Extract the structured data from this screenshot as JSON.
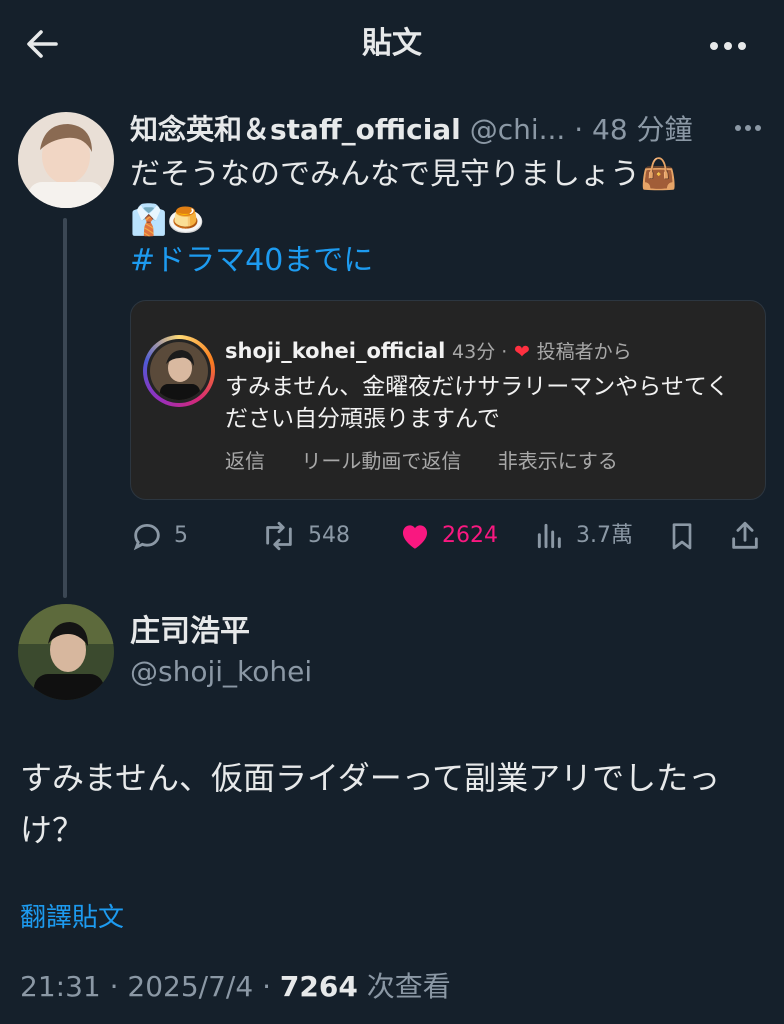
{
  "header": {
    "title": "貼文"
  },
  "quoted_tweet": {
    "author_name": "知念英和＆staff_official",
    "author_handle": "@chi...",
    "separator": "·",
    "time": "48 分鐘",
    "text_line1": "だそうなのでみんなで見守りましょう👜",
    "text_line2": "👔🍮",
    "hashtag": "#ドラマ40までに",
    "embed": {
      "username": "shoji_kohei_official",
      "meta": "43分 ·",
      "heart": "❤",
      "from_label": "投稿者から",
      "text": "すみません、金曜夜だけサラリーマンやらせてください自分頑張りますんで",
      "actions": {
        "reply": "返信",
        "reel_reply": "リール動画で返信",
        "hide": "非表示にする"
      }
    },
    "stats": {
      "replies": "5",
      "reposts": "548",
      "likes": "2624",
      "views": "3.7萬"
    },
    "colors": {
      "like": "#f91880",
      "link": "#1d9bf0"
    }
  },
  "main_tweet": {
    "author_name": "庄司浩平",
    "author_handle": "@shoji_kohei",
    "text": "すみません、仮面ライダーって副業アリでしたっけ？",
    "translate_label": "翻譯貼文",
    "time": "21:31",
    "sep1": "·",
    "date": "2025/7/4",
    "sep2": "·",
    "views_count": "7264",
    "views_label": "次查看"
  }
}
